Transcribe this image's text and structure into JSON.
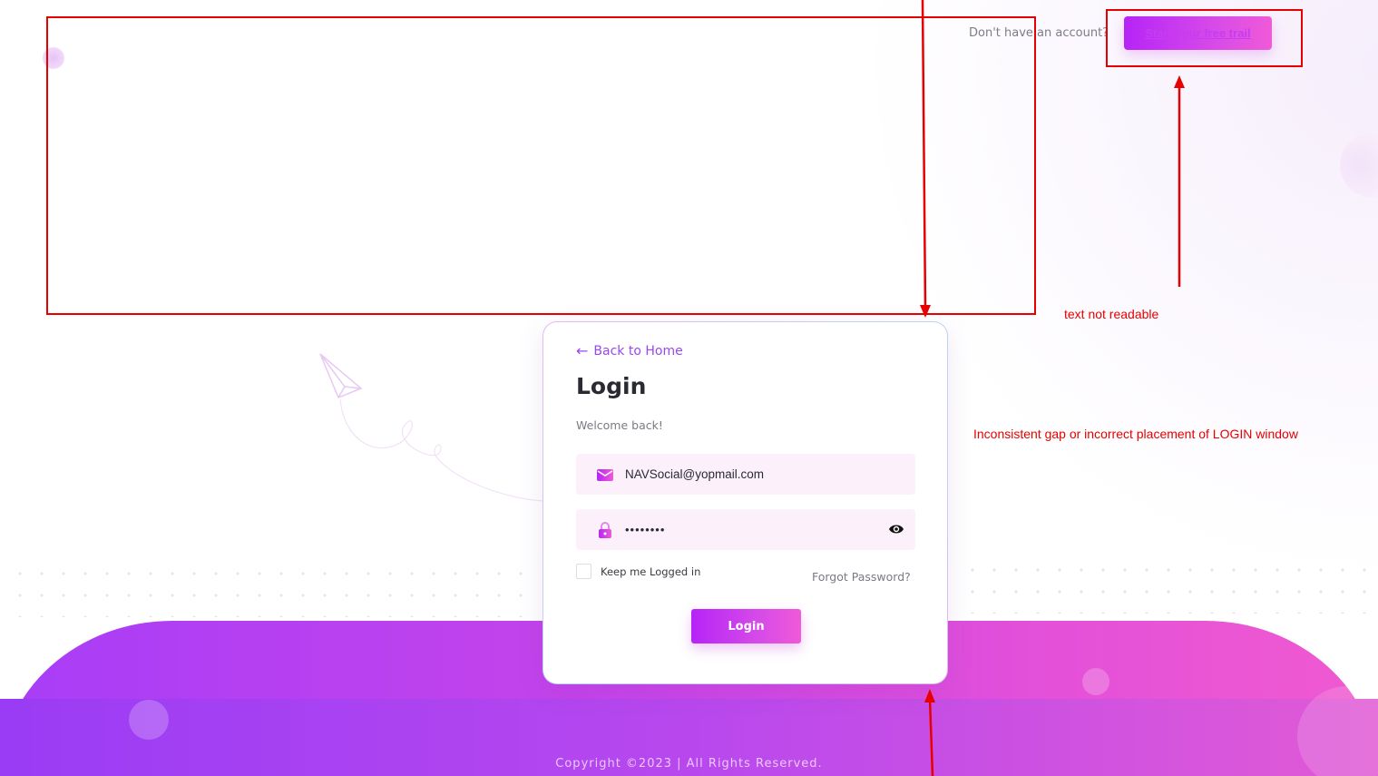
{
  "header": {
    "signup_prompt": "Don't have an account?",
    "trial_button_label": "Start your free trail"
  },
  "login_card": {
    "back_link": "Back to Home",
    "title": "Login",
    "subtitle": "Welcome back!",
    "email": {
      "value": "NAVSocial@yopmail.com",
      "icon": "envelope-icon"
    },
    "password": {
      "value": "••••••••",
      "icon": "lock-icon",
      "toggle_icon": "eye-icon"
    },
    "remember_label": "Keep me Logged in",
    "remember_checked": false,
    "forgot_label": "Forgot Password?",
    "submit_label": "Login"
  },
  "footer": {
    "copyright": "Copyright ©2023 | All Rights Reserved."
  },
  "annotations": {
    "readability_note": "text not readable",
    "placement_note": "Inconsistent gap or incorrect placement of LOGIN window",
    "color": "#e60000"
  },
  "theme": {
    "accent_start": "#b624f7",
    "accent_end": "#f05ad8"
  }
}
